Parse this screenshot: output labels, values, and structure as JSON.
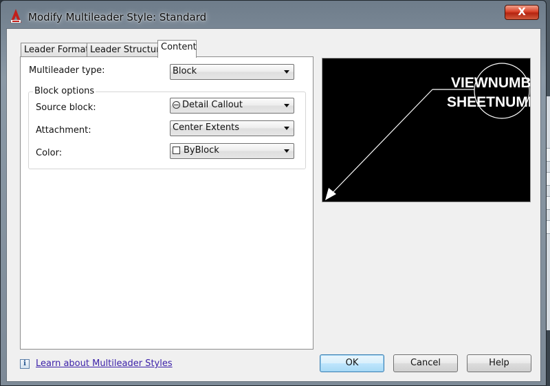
{
  "window": {
    "title": "Modify Multileader Style: Standard",
    "close_label": "X"
  },
  "tabs": [
    {
      "label": "Leader Format",
      "active": false
    },
    {
      "label": "Leader Structure",
      "active": false
    },
    {
      "label": "Content",
      "active": true
    }
  ],
  "content": {
    "multileader_type": {
      "label": "Multileader type:",
      "value": "Block"
    },
    "block_options": {
      "legend": "Block options",
      "source_block": {
        "label": "Source block:",
        "value": "Detail Callout",
        "icon": "detail-callout-icon"
      },
      "attachment": {
        "label": "Attachment:",
        "value": "Center Extents"
      },
      "color": {
        "label": "Color:",
        "value": "ByBlock",
        "icon": "color-swatch-icon"
      }
    }
  },
  "preview": {
    "line1": "VIEWNUMBER",
    "line2": "SHEETNUMBER",
    "background": "#000000",
    "foreground": "#ffffff"
  },
  "footer": {
    "help_link": "Learn about Multileader Styles",
    "ok_label": "OK",
    "cancel_label": "Cancel",
    "help_label": "Help"
  },
  "colors": {
    "default_button_border": "#3c7fb1",
    "link": "#3a1fa8",
    "close_button": "#c8351d"
  }
}
